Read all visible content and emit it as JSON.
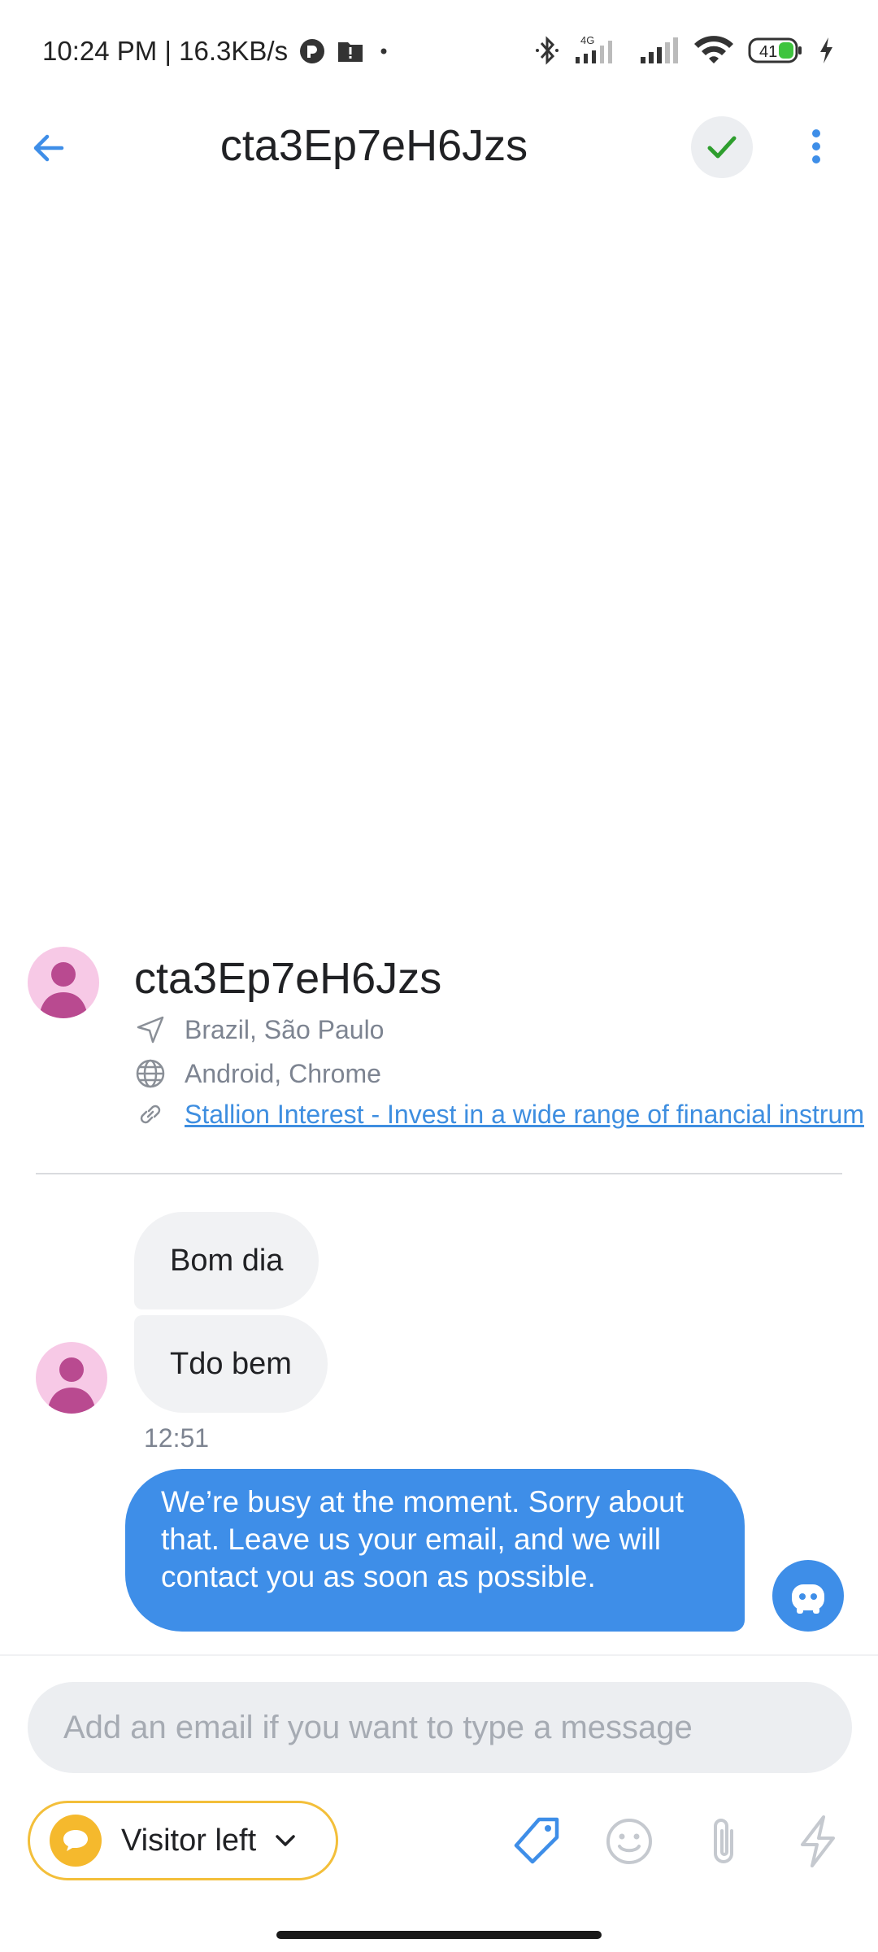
{
  "status_bar": {
    "time_speed": "10:24 PM | 16.3KB/s",
    "network_label": "4G",
    "battery": "41"
  },
  "header": {
    "title": "cta3Ep7eH6Jzs"
  },
  "visitor": {
    "name": "cta3Ep7eH6Jzs",
    "location": "Brazil, São Paulo",
    "device": "Android, Chrome",
    "page_link": "Stallion Interest - Invest in a wide range of financial instrum"
  },
  "messages": {
    "incoming": [
      "Bom dia",
      "Tdo bem"
    ],
    "timestamp": "12:51",
    "outgoing": "We’re busy at the moment. Sorry about that. Leave us your email, and we will contact you as soon as possible."
  },
  "composer": {
    "placeholder": "Add an email if you want to type a message"
  },
  "footer": {
    "status_label": "Visitor left"
  },
  "colors": {
    "accent": "#3e8ee8",
    "status_yellow": "#f5b92d",
    "resolve_green": "#2e9e2e",
    "avatar_pink": "#f7c9e6",
    "avatar_figure": "#b94a90"
  }
}
